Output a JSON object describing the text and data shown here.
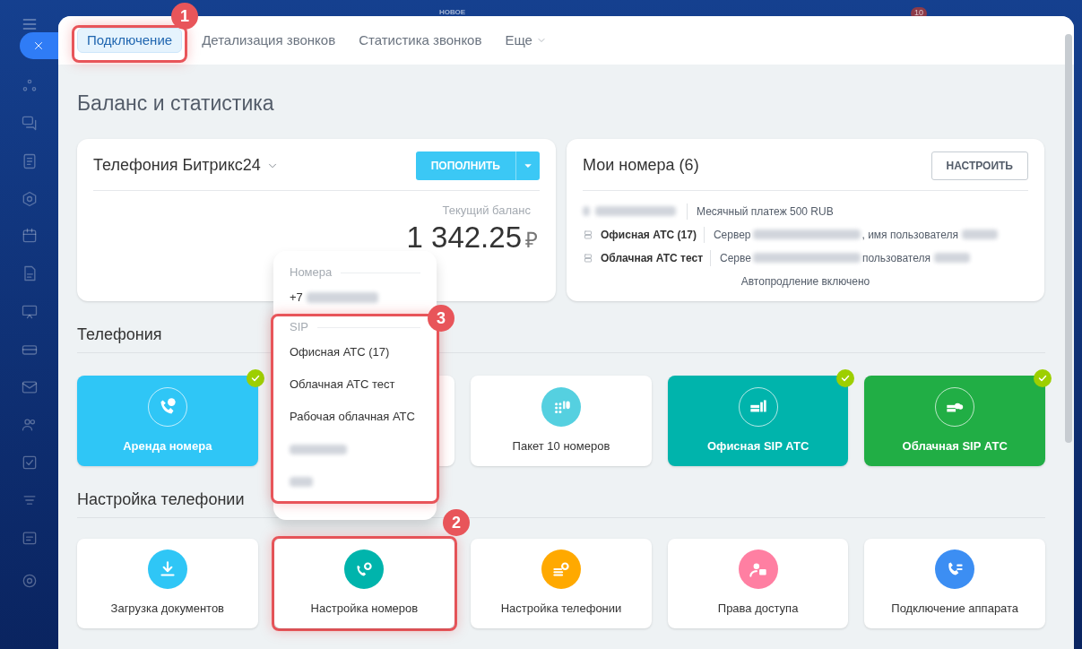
{
  "topbar": {
    "label": "НОВОЕ",
    "badge": "10"
  },
  "tabs": [
    {
      "label": "Подключение",
      "selected": true,
      "kind": "tab"
    },
    {
      "label": "Детализация звонков",
      "selected": false,
      "kind": "tab"
    },
    {
      "label": "Статистика звонков",
      "selected": false,
      "kind": "tab"
    },
    {
      "label": "Еще",
      "selected": false,
      "kind": "more"
    }
  ],
  "page_title": "Баланс и статистика",
  "balance_card": {
    "title": "Телефония Битрикс24",
    "button": "ПОПОЛНИТЬ",
    "balance_label": "Текущий баланс",
    "balance": "1 342.25",
    "currency": "₽"
  },
  "numbers_card": {
    "title": "Мои номера (6)",
    "button": "НАСТРОИТЬ",
    "rows": [
      {
        "kind": "phone",
        "detail": [
          "Месячный платеж 500 RUB"
        ]
      },
      {
        "kind": "sip",
        "name": "Офисная АТС (17)",
        "detail": [
          "Сервер",
          ", имя пользователя"
        ]
      },
      {
        "kind": "sip",
        "name": "Облачная АТС тест",
        "detail": [
          "Серве",
          "пользователя"
        ]
      }
    ],
    "footer": "Автопродление включено"
  },
  "sections": [
    {
      "title": "Телефония",
      "tiles": [
        {
          "label": "Аренда номера",
          "kind": "filled",
          "color": "#2fc6f6",
          "connected": true
        },
        {
          "kind": "covered"
        },
        {
          "label": "Пакет 10 номеров",
          "kind": "plain",
          "color": "#55d0e0",
          "connected": false
        },
        {
          "label": "Офисная SIP АТС",
          "kind": "filled",
          "color": "#00b4ac",
          "connected": true
        },
        {
          "label": "Облачная SIP АТС",
          "kind": "filled",
          "color": "#21ae45",
          "connected": true
        }
      ]
    },
    {
      "title": "Настройка телефонии",
      "tiles": [
        {
          "label": "Загрузка документов",
          "kind": "plain",
          "color": "#2fc6f6",
          "connected": false
        },
        {
          "label": "Настройка номеров",
          "kind": "plain",
          "color": "#00b4ac",
          "connected": false
        },
        {
          "label": "Настройка телефонии",
          "kind": "plain",
          "color": "#ffa900",
          "connected": false
        },
        {
          "label": "Права доступа",
          "kind": "plain",
          "color": "#ff7fa2",
          "connected": false
        },
        {
          "label": "Подключение аппарата",
          "kind": "plain",
          "color": "#3c8ef3",
          "connected": false
        }
      ]
    }
  ],
  "dropdown": {
    "groups": [
      {
        "title": "Номера",
        "items": [
          {
            "label": "+7",
            "redacted": true
          }
        ]
      },
      {
        "title": "SIP",
        "items": [
          {
            "label": "Офисная АТС (17)",
            "redacted": false
          },
          {
            "label": "Облачная АТС тест",
            "redacted": false
          },
          {
            "label": "Рабочая облачная АТС",
            "redacted": false
          },
          {
            "redacted": true
          },
          {
            "redacted": true
          }
        ]
      }
    ]
  },
  "callouts": [
    {
      "label": "1",
      "kind": "tab"
    },
    {
      "label": "2",
      "kind": "setup-tile"
    },
    {
      "label": "3",
      "kind": "dropdown"
    }
  ]
}
